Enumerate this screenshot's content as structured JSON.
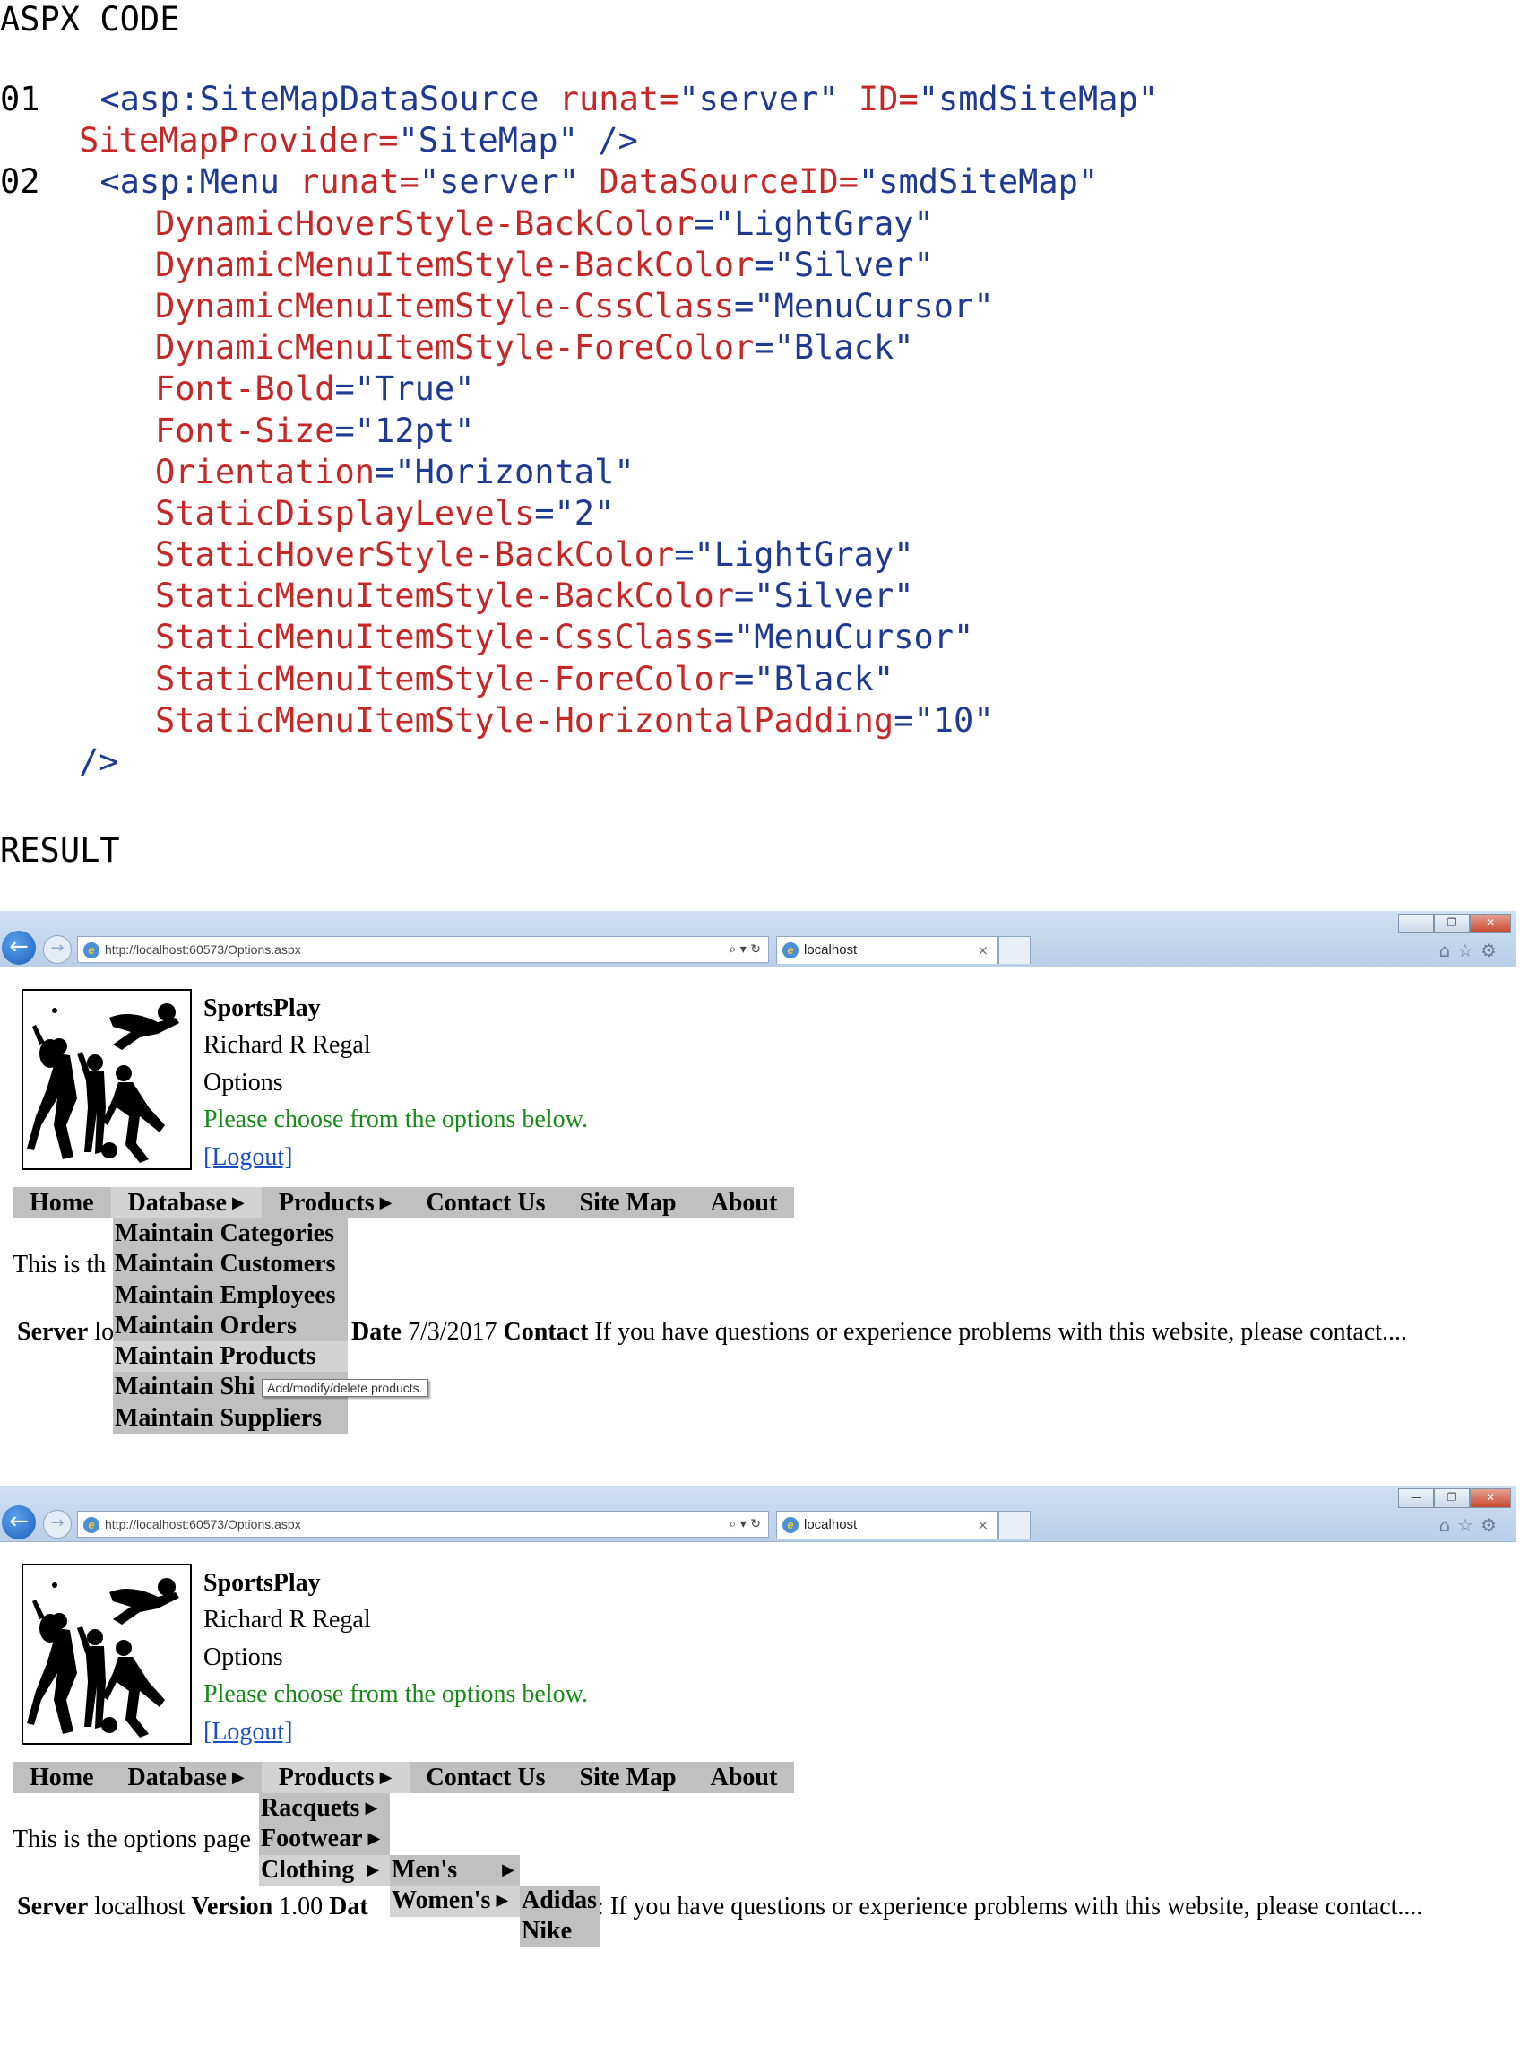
{
  "code_section": {
    "heading": "ASPX CODE",
    "result_heading": "RESULT",
    "line1_number": "01",
    "line1_tag": "<asp:SiteMapDataSource",
    "line1_attr1_name": "runat=",
    "line1_attr1_value": "\"server\"",
    "line1_attr2_name": "ID=",
    "line1_attr2_value": "\"smdSiteMap\"",
    "line1_cont_name": "SiteMapProvider=",
    "line1_cont_value": "\"SiteMap\"",
    "line1_close": "/>",
    "line2_number": "02",
    "line2_tag": "<asp:Menu",
    "line2_attr1_name": "runat=",
    "line2_attr1_value": "\"server\"",
    "line2_attr2_name": "DataSourceID=",
    "line2_attr2_value": "\"smdSiteMap\"",
    "attributes": [
      {
        "name": "DynamicHoverStyle-BackColor",
        "value": "\"LightGray\""
      },
      {
        "name": "DynamicMenuItemStyle-BackColor",
        "value": "\"Silver\""
      },
      {
        "name": "DynamicMenuItemStyle-CssClass",
        "value": "\"MenuCursor\""
      },
      {
        "name": "DynamicMenuItemStyle-ForeColor",
        "value": "\"Black\""
      },
      {
        "name": "Font-Bold",
        "value": "\"True\""
      },
      {
        "name": "Font-Size",
        "value": "\"12pt\""
      },
      {
        "name": "Orientation",
        "value": "\"Horizontal\""
      },
      {
        "name": "StaticDisplayLevels",
        "value": "\"2\""
      },
      {
        "name": "StaticHoverStyle-BackColor",
        "value": "\"LightGray\""
      },
      {
        "name": "StaticMenuItemStyle-BackColor",
        "value": "\"Silver\""
      },
      {
        "name": "StaticMenuItemStyle-CssClass",
        "value": "\"MenuCursor\""
      },
      {
        "name": "StaticMenuItemStyle-ForeColor",
        "value": "\"Black\""
      },
      {
        "name": "StaticMenuItemStyle-HorizontalPadding",
        "value": "\"10\""
      }
    ],
    "equals": "=",
    "menu_close": "/>"
  },
  "browser": {
    "url": "http://localhost:60573/Options.aspx",
    "tab_title": "localhost",
    "address_tools": "⌕ ▾ ↻",
    "tab_close": "×",
    "minimize": "—",
    "restore": "❐",
    "close": "✕",
    "toolbar_icons": "⌂☆⚙",
    "back_glyph": "←",
    "forward_glyph": "→",
    "ie_glyph": "e"
  },
  "page_header": {
    "site_name": "SportsPlay",
    "user_name": "Richard R Regal",
    "page_name": "Options",
    "message": "Please choose from the options below.",
    "logout": "[Logout]"
  },
  "menu": {
    "home": "Home",
    "database": "Database",
    "products": "Products",
    "contact": "Contact Us",
    "sitemap": "Site Map",
    "about": "About",
    "arrow": "▶"
  },
  "screenshot1": {
    "database_submenu": [
      "Maintain Categories",
      "Maintain Customers",
      "Maintain Employees",
      "Maintain Orders",
      "Maintain Products",
      "Maintain Shi",
      "Maintain Suppliers"
    ],
    "body_text_visible": "This is th",
    "footer_server_label": "Server",
    "footer_server_partial": "lo",
    "footer_date_label": "Date",
    "footer_date_value": "7/3/2017",
    "footer_contact_label": "Contact",
    "footer_contact_text": "If you have questions or experience problems with this website, please contact....",
    "tooltip": "Add/modify/delete products."
  },
  "screenshot2": {
    "products_submenu": [
      "Racquets",
      "Footwear",
      "Clothing"
    ],
    "clothing_submenu": [
      "Men's",
      "Women's"
    ],
    "womens_submenu": [
      "Adidas",
      "Nike"
    ],
    "body_text_visible": "This is the options page",
    "footer_server_label": "Server",
    "footer_server_value": "localhost",
    "footer_version_label": "Version",
    "footer_version_value": "1.00",
    "footer_date_partial": "Dat",
    "footer_contact_tail": ": If you have questions or experience problems with this website, please contact...."
  },
  "colors": {
    "code_blue": "#1f3a93",
    "code_red": "#c62828",
    "menu_silver": "#c0c0c0",
    "menu_lightgray": "#d3d3d3",
    "message_green": "#188a18",
    "link_blue": "#1a4fc4"
  }
}
